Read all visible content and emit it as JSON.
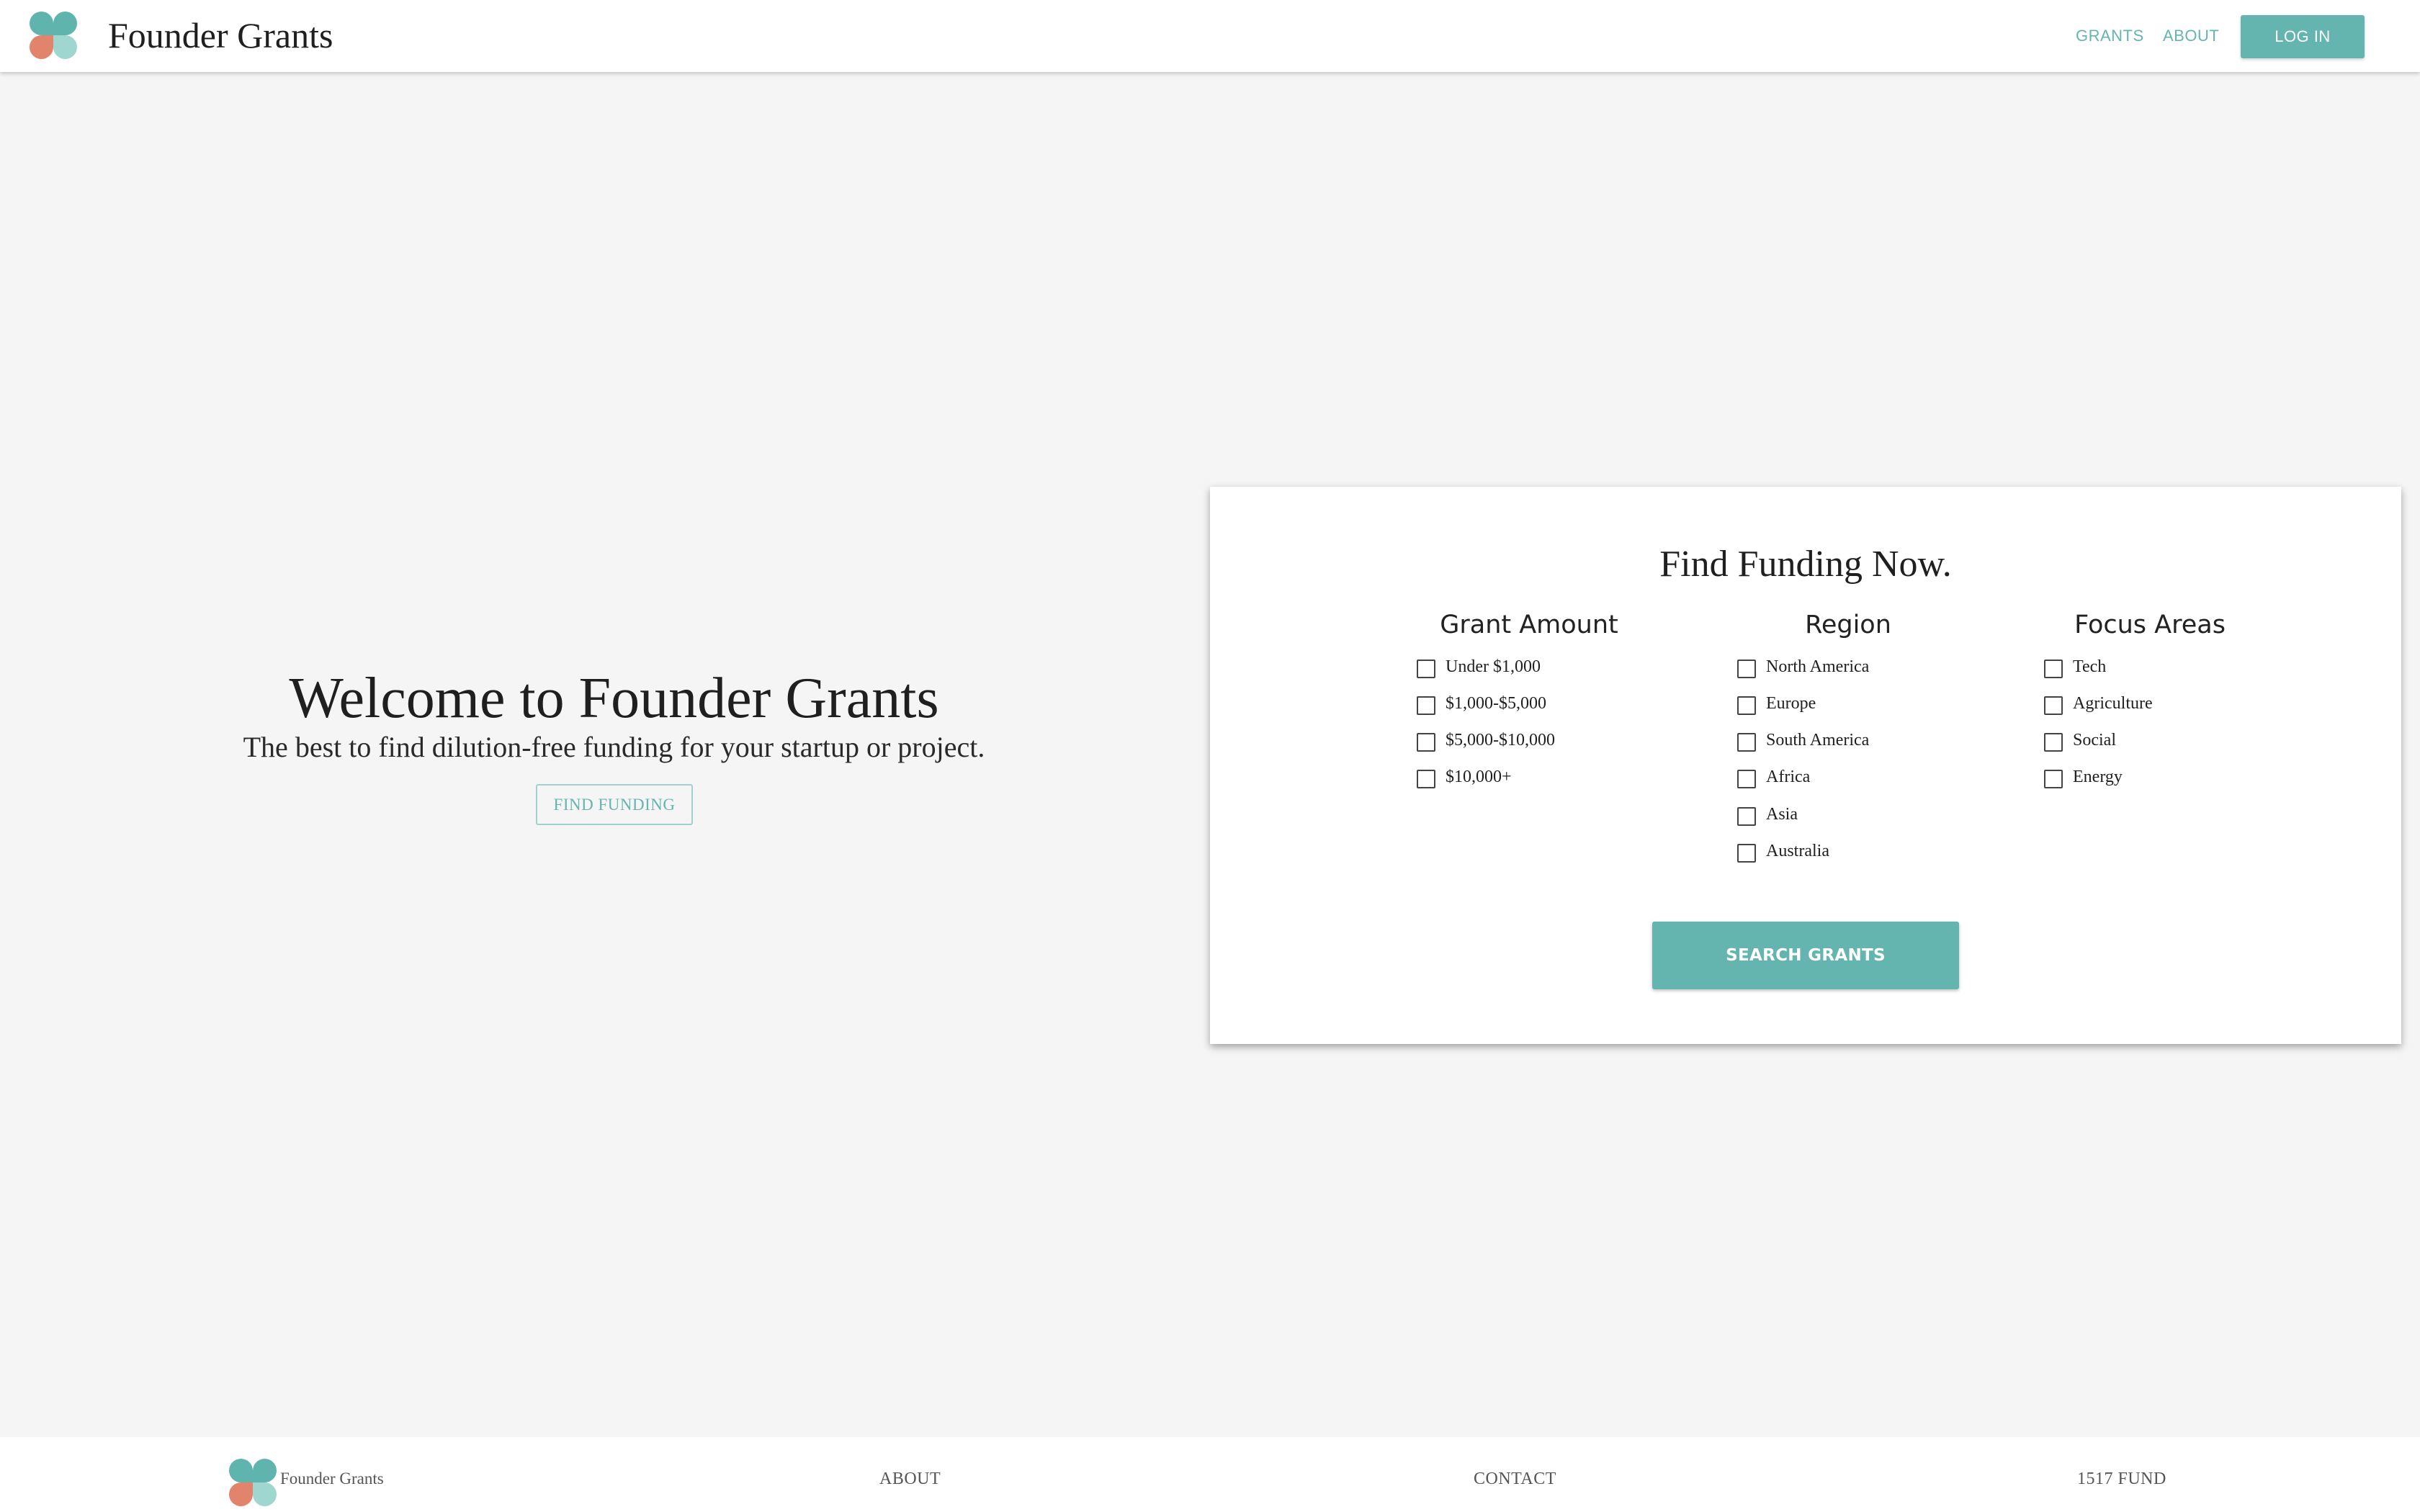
{
  "colors": {
    "accent": "#64b5af",
    "accent_light": "#9fd2cc",
    "logo_teal": "#5fb4ae",
    "logo_coral": "#e2836b",
    "logo_mint": "#9fd6d0",
    "page_bg": "#f5f5f5"
  },
  "header": {
    "logo_icon": "clover-logo-icon",
    "brand": "Founder Grants",
    "nav": {
      "grants": "GRANTS",
      "about": "ABOUT"
    },
    "login_label": "LOG IN"
  },
  "hero": {
    "title": "Welcome to Founder Grants",
    "subtitle": "The best to find dilution-free funding for your startup or project.",
    "cta_label": "FIND FUNDING"
  },
  "search_card": {
    "title": "Find Funding Now.",
    "columns": [
      {
        "heading": "Grant Amount",
        "options": [
          {
            "label": "Under $1,000",
            "checked": false
          },
          {
            "label": "$1,000-$5,000",
            "checked": false
          },
          {
            "label": "$5,000-$10,000",
            "checked": false
          },
          {
            "label": "$10,000+",
            "checked": false
          }
        ]
      },
      {
        "heading": "Region",
        "options": [
          {
            "label": "North America",
            "checked": false
          },
          {
            "label": "Europe",
            "checked": false
          },
          {
            "label": "South America",
            "checked": false
          },
          {
            "label": "Africa",
            "checked": false
          },
          {
            "label": "Asia",
            "checked": false
          },
          {
            "label": "Australia",
            "checked": false
          }
        ]
      },
      {
        "heading": "Focus Areas",
        "options": [
          {
            "label": "Tech",
            "checked": false
          },
          {
            "label": "Agriculture",
            "checked": false
          },
          {
            "label": "Social",
            "checked": false
          },
          {
            "label": "Energy",
            "checked": false
          }
        ]
      }
    ],
    "search_label": "SEARCH GRANTS"
  },
  "footer": {
    "logo_icon": "clover-logo-icon",
    "brand": "Founder Grants",
    "links": {
      "about": "ABOUT",
      "contact": "CONTACT",
      "fund": "1517 FUND"
    }
  }
}
